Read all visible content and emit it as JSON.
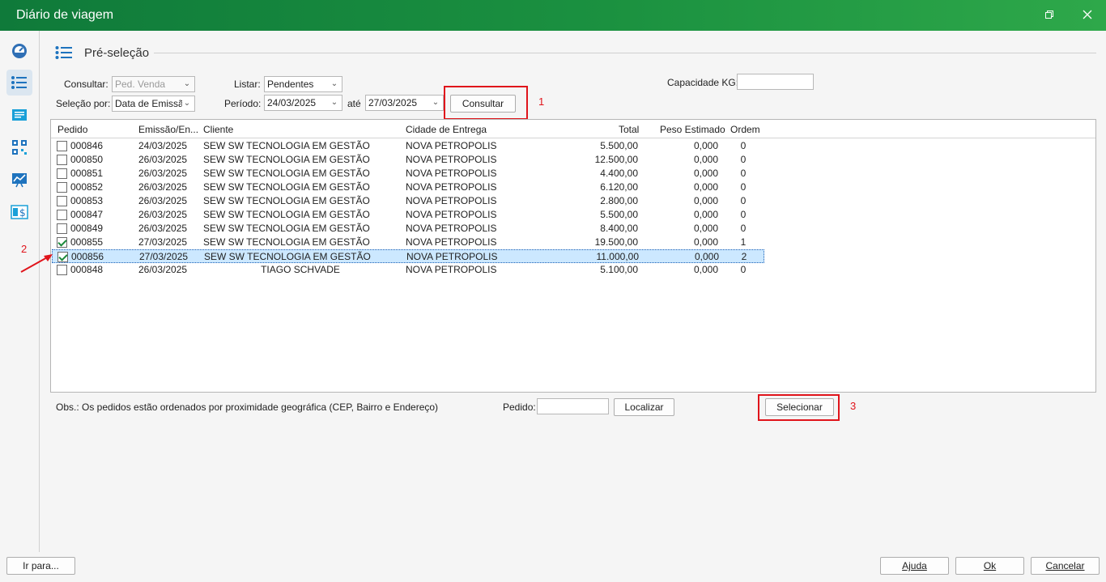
{
  "window": {
    "title": "Diário de viagem",
    "restore_icon": "restore-icon",
    "close_icon": "close-icon"
  },
  "sidebar": {
    "items": [
      {
        "icon": "dashboard-icon"
      },
      {
        "icon": "list-icon",
        "active": true
      },
      {
        "icon": "document-icon"
      },
      {
        "icon": "qr-code-icon"
      },
      {
        "icon": "chart-icon"
      },
      {
        "icon": "invoice-icon"
      }
    ]
  },
  "section": {
    "title": "Pré-seleção",
    "icon": "list-icon"
  },
  "filters": {
    "consultar_label": "Consultar:",
    "consultar_value": "Ped. Venda",
    "listar_label": "Listar:",
    "listar_value": "Pendentes",
    "selecao_label": "Seleção por:",
    "selecao_value": "Data de Emissão",
    "periodo_label": "Período:",
    "periodo_de": "24/03/2025",
    "ate_label": "até",
    "periodo_ate": "27/03/2025",
    "consultar_button": "Consultar",
    "capacidade_label": "Capacidade KG:",
    "capacidade_value": ""
  },
  "annotations": {
    "one": "1",
    "two": "2",
    "three": "3"
  },
  "table": {
    "headers": [
      "Pedido",
      "Emissão/En...",
      "Cliente",
      "Cidade de Entrega",
      "Total",
      "Peso Estimado",
      "Ordem"
    ],
    "rows": [
      {
        "checked": false,
        "pedido": "000846",
        "emissao": "24/03/2025",
        "cliente": "SEW SW TECNOLOGIA EM GESTÃO",
        "cidade": "NOVA PETROPOLIS",
        "total": "5.500,00",
        "peso": "0,000",
        "ordem": "0"
      },
      {
        "checked": false,
        "pedido": "000850",
        "emissao": "26/03/2025",
        "cliente": "SEW SW TECNOLOGIA EM GESTÃO",
        "cidade": "NOVA PETROPOLIS",
        "total": "12.500,00",
        "peso": "0,000",
        "ordem": "0"
      },
      {
        "checked": false,
        "pedido": "000851",
        "emissao": "26/03/2025",
        "cliente": "SEW SW TECNOLOGIA EM GESTÃO",
        "cidade": "NOVA PETROPOLIS",
        "total": "4.400,00",
        "peso": "0,000",
        "ordem": "0"
      },
      {
        "checked": false,
        "pedido": "000852",
        "emissao": "26/03/2025",
        "cliente": "SEW SW TECNOLOGIA EM GESTÃO",
        "cidade": "NOVA PETROPOLIS",
        "total": "6.120,00",
        "peso": "0,000",
        "ordem": "0"
      },
      {
        "checked": false,
        "pedido": "000853",
        "emissao": "26/03/2025",
        "cliente": "SEW SW TECNOLOGIA EM GESTÃO",
        "cidade": "NOVA PETROPOLIS",
        "total": "2.800,00",
        "peso": "0,000",
        "ordem": "0"
      },
      {
        "checked": false,
        "pedido": "000847",
        "emissao": "26/03/2025",
        "cliente": "SEW SW TECNOLOGIA EM GESTÃO",
        "cidade": "NOVA PETROPOLIS",
        "total": "5.500,00",
        "peso": "0,000",
        "ordem": "0"
      },
      {
        "checked": false,
        "pedido": "000849",
        "emissao": "26/03/2025",
        "cliente": "SEW SW TECNOLOGIA EM GESTÃO",
        "cidade": "NOVA PETROPOLIS",
        "total": "8.400,00",
        "peso": "0,000",
        "ordem": "0"
      },
      {
        "checked": true,
        "pedido": "000855",
        "emissao": "27/03/2025",
        "cliente": "SEW SW TECNOLOGIA EM GESTÃO",
        "cidade": "NOVA PETROPOLIS",
        "total": "19.500,00",
        "peso": "0,000",
        "ordem": "1"
      },
      {
        "checked": true,
        "selected": true,
        "pedido": "000856",
        "emissao": "27/03/2025",
        "cliente": "SEW SW TECNOLOGIA EM GESTÃO",
        "cidade": "NOVA PETROPOLIS",
        "total": "11.000,00",
        "peso": "0,000",
        "ordem": "2"
      },
      {
        "checked": false,
        "pedido": "000848",
        "emissao": "26/03/2025",
        "cliente": "TIAGO SCHVADE",
        "cidade": "NOVA PETROPOLIS",
        "total": "5.100,00",
        "peso": "0,000",
        "ordem": "0"
      }
    ]
  },
  "footer": {
    "obs": "Obs.: Os pedidos estão ordenados por proximidade geográfica (CEP, Bairro e Endereço)",
    "pedido_label": "Pedido:",
    "pedido_value": "",
    "localizar_button": "Localizar",
    "selecionar_button": "Selecionar"
  },
  "bottom": {
    "ir_para": "Ir para...",
    "ajuda": "Ajuda",
    "ok": "Ok",
    "cancelar": "Cancelar"
  },
  "colors": {
    "titlebar": "#1b9140",
    "annotation": "#e0141b",
    "selection": "#cce8ff"
  }
}
